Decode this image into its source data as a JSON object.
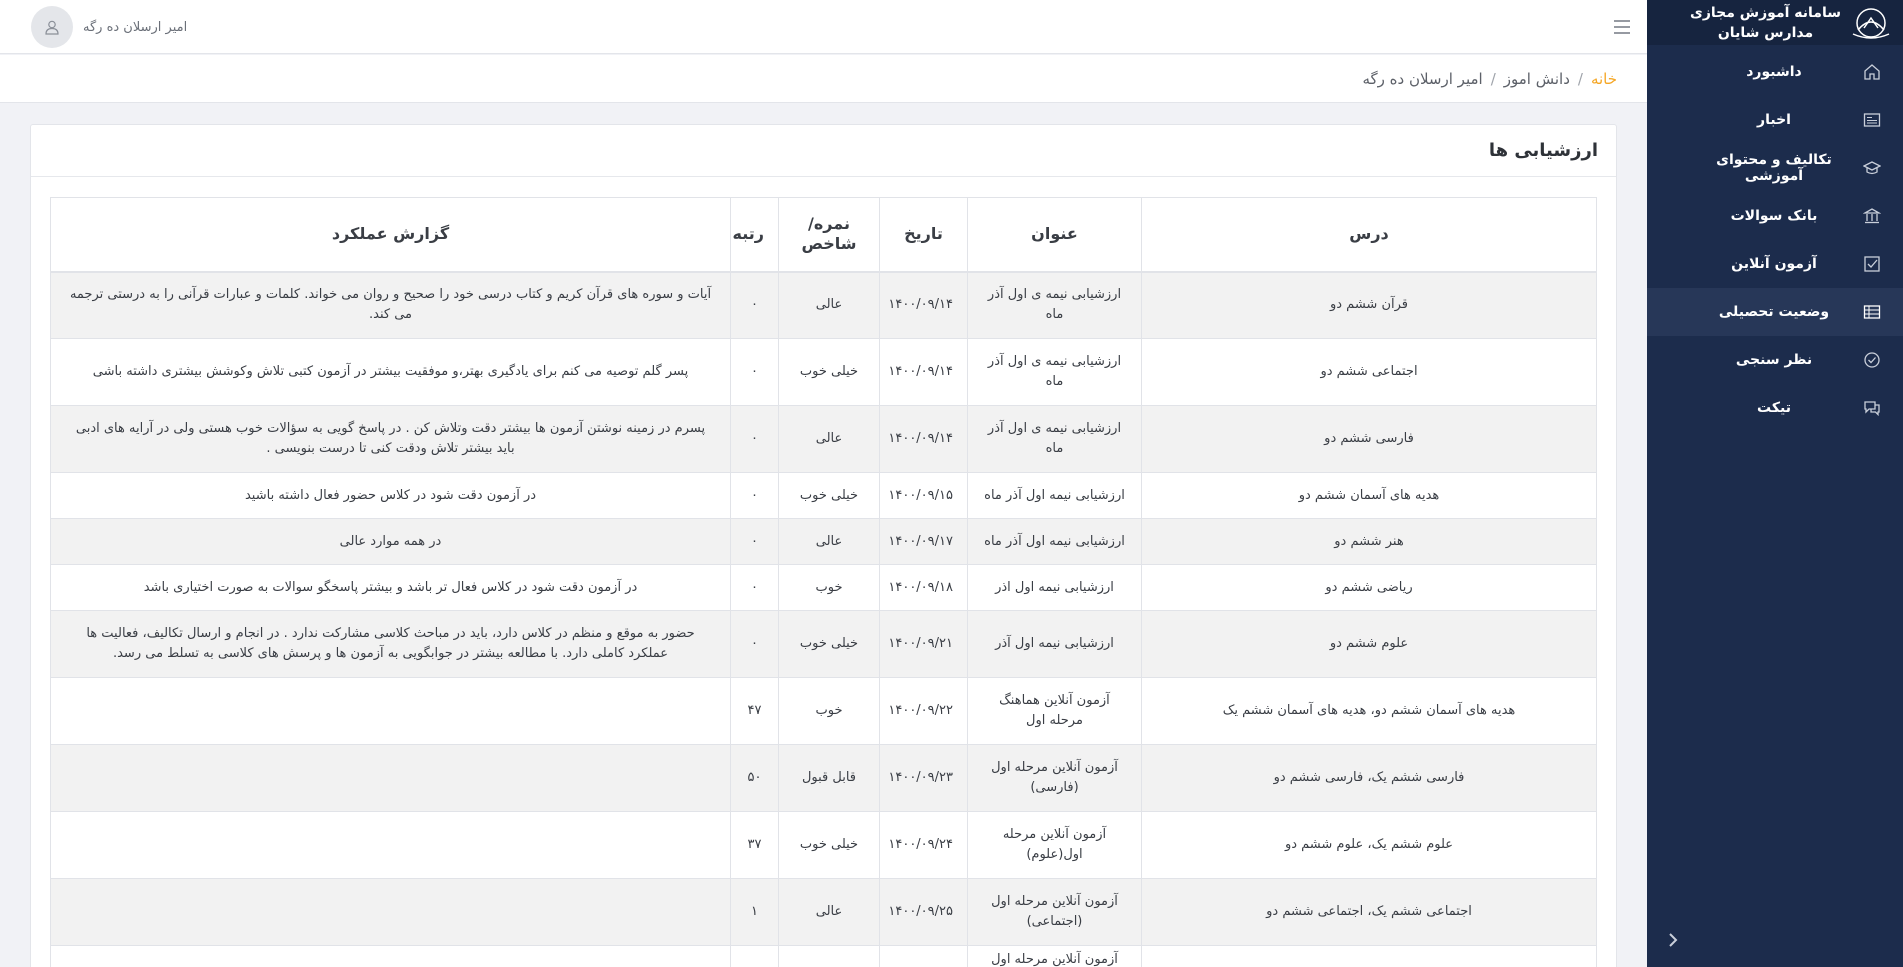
{
  "sidebar": {
    "brand_line1": "سامانه آموزش مجازی",
    "brand_line2": "مدارس شایان",
    "logo_icon": "school-emblem-icon",
    "items": [
      {
        "label": "داشبورد",
        "icon": "home-icon",
        "active": false
      },
      {
        "label": "اخبار",
        "icon": "newspaper-icon",
        "active": false
      },
      {
        "label": "تکالیف و محتوای آموزشی",
        "icon": "graduation-cap-icon",
        "active": false
      },
      {
        "label": "بانک سوالات",
        "icon": "bank-icon",
        "active": false
      },
      {
        "label": "آزمون آنلاین",
        "icon": "checkbox-icon",
        "active": false
      },
      {
        "label": "وضعیت تحصیلی",
        "icon": "grid-icon",
        "active": true
      },
      {
        "label": "نظر سنجی",
        "icon": "check-circle-icon",
        "active": false
      },
      {
        "label": "تیکت",
        "icon": "chat-icon",
        "active": false
      }
    ]
  },
  "header": {
    "user_name": "امیر ارسلان ده رگه",
    "avatar_icon": "user-icon",
    "menu_icon": "hamburger-icon"
  },
  "breadcrumb": {
    "home": "خانه",
    "separator": "/",
    "section": "دانش اموز",
    "current": "امیر ارسلان ده رگه"
  },
  "card": {
    "title": "ارزشیابی ها"
  },
  "table": {
    "headers": {
      "course": "درس",
      "title": "عنوان",
      "date": "تاریخ",
      "grade": "نمره/ شاخص",
      "rank": "رتبه",
      "report": "گزارش عملکرد"
    },
    "rows": [
      {
        "course": "قرآن ششم دو",
        "title": "ارزشیابی نیمه ی اول آذر ماه",
        "date": "۱۴۰۰/۰۹/۱۴",
        "grade": "عالی",
        "rank": "۰",
        "report": "آیات و سوره های قرآن کریم و کتاب درسی خود را صحیح و روان می خواند. کلمات و عبارات قرآنی را به درستی ترجمه می کند."
      },
      {
        "course": "اجتماعی ششم دو",
        "title": "ارزشیابی نیمه ی اول آذر ماه",
        "date": "۱۴۰۰/۰۹/۱۴",
        "grade": "خیلی خوب",
        "rank": "۰",
        "report": "پسر گلم توصیه می کنم برای یادگیری بهتر،و موفقیت بیشتر در آزمون کتبی تلاش وکوشش بیشتری داشته باشی"
      },
      {
        "course": "فارسی ششم دو",
        "title": "ارزشیابی نیمه ی اول آذر ماه",
        "date": "۱۴۰۰/۰۹/۱۴",
        "grade": "عالی",
        "rank": "۰",
        "report": "پسرم در زمینه نوشتن آزمون ها بیشتر دقت وتلاش کن . در پاسخ گویی به سؤالات خوب هستی ولی در آرایه های ادبی باید بیشتر تلاش ودقت کنی تا درست بنویسی ."
      },
      {
        "course": "هدیه های آسمان ششم دو",
        "title": "ارزشیابی نیمه اول آذر ماه",
        "date": "۱۴۰۰/۰۹/۱۵",
        "grade": "خیلی خوب",
        "rank": "۰",
        "report": "در آزمون دقت شود در کلاس حضور فعال داشته باشید"
      },
      {
        "course": "هنر ششم دو",
        "title": "ارزشیابی نیمه اول آذر ماه",
        "date": "۱۴۰۰/۰۹/۱۷",
        "grade": "عالی",
        "rank": "۰",
        "report": "در همه موارد عالی"
      },
      {
        "course": "ریاضی ششم دو",
        "title": "ارزشیابی نیمه اول اذر",
        "date": "۱۴۰۰/۰۹/۱۸",
        "grade": "خوب",
        "rank": "۰",
        "report": "در آزمون دقت شود در کلاس فعال تر باشد و بیشتر پاسخگو سوالات به صورت اختیاری باشد"
      },
      {
        "course": "علوم ششم دو",
        "title": "ارزشیابی نیمه اول آذر",
        "date": "۱۴۰۰/۰۹/۲۱",
        "grade": "خیلی خوب",
        "rank": "۰",
        "report": "حضور به موقع و منظم در کلاس دارد، باید در مباحث کلاسی مشارکت ندارد . در انجام و ارسال تکالیف، فعالیت ها عملکرد کاملی دارد. با مطالعه بیشتر در جوابگویی به آزمون ها و پرسش های کلاسی به تسلط می رسد."
      },
      {
        "course": "هدیه های آسمان ششم دو، هدیه های آسمان ششم یک",
        "title": "آزمون آنلاین هماهنگ مرحله اول",
        "date": "۱۴۰۰/۰۹/۲۲",
        "grade": "خوب",
        "rank": "۴۷",
        "report": ""
      },
      {
        "course": "فارسی ششم یک، فارسی ششم دو",
        "title": "آزمون آنلاین مرحله اول (فارسی)",
        "date": "۱۴۰۰/۰۹/۲۳",
        "grade": "قابل قبول",
        "rank": "۵۰",
        "report": ""
      },
      {
        "course": "علوم ششم یک، علوم ششم دو",
        "title": "آزمون آنلاین مرحله اول(علوم)",
        "date": "۱۴۰۰/۰۹/۲۴",
        "grade": "خیلی خوب",
        "rank": "۳۷",
        "report": ""
      },
      {
        "course": "اجتماعی ششم یک، اجتماعی ششم دو",
        "title": "آزمون آنلاین مرحله اول (اجتماعی)",
        "date": "۱۴۰۰/۰۹/۲۵",
        "grade": "عالی",
        "rank": "۱",
        "report": ""
      },
      {
        "course": "",
        "title": "آزمون آنلاین مرحله اول",
        "date": "",
        "grade": "",
        "rank": "",
        "report": ""
      }
    ]
  },
  "colors": {
    "sidebar_bg": "#1c2c4c",
    "sidebar_active": "#273758",
    "accent": "#f5a623",
    "stripe": "#f2f2f2"
  }
}
